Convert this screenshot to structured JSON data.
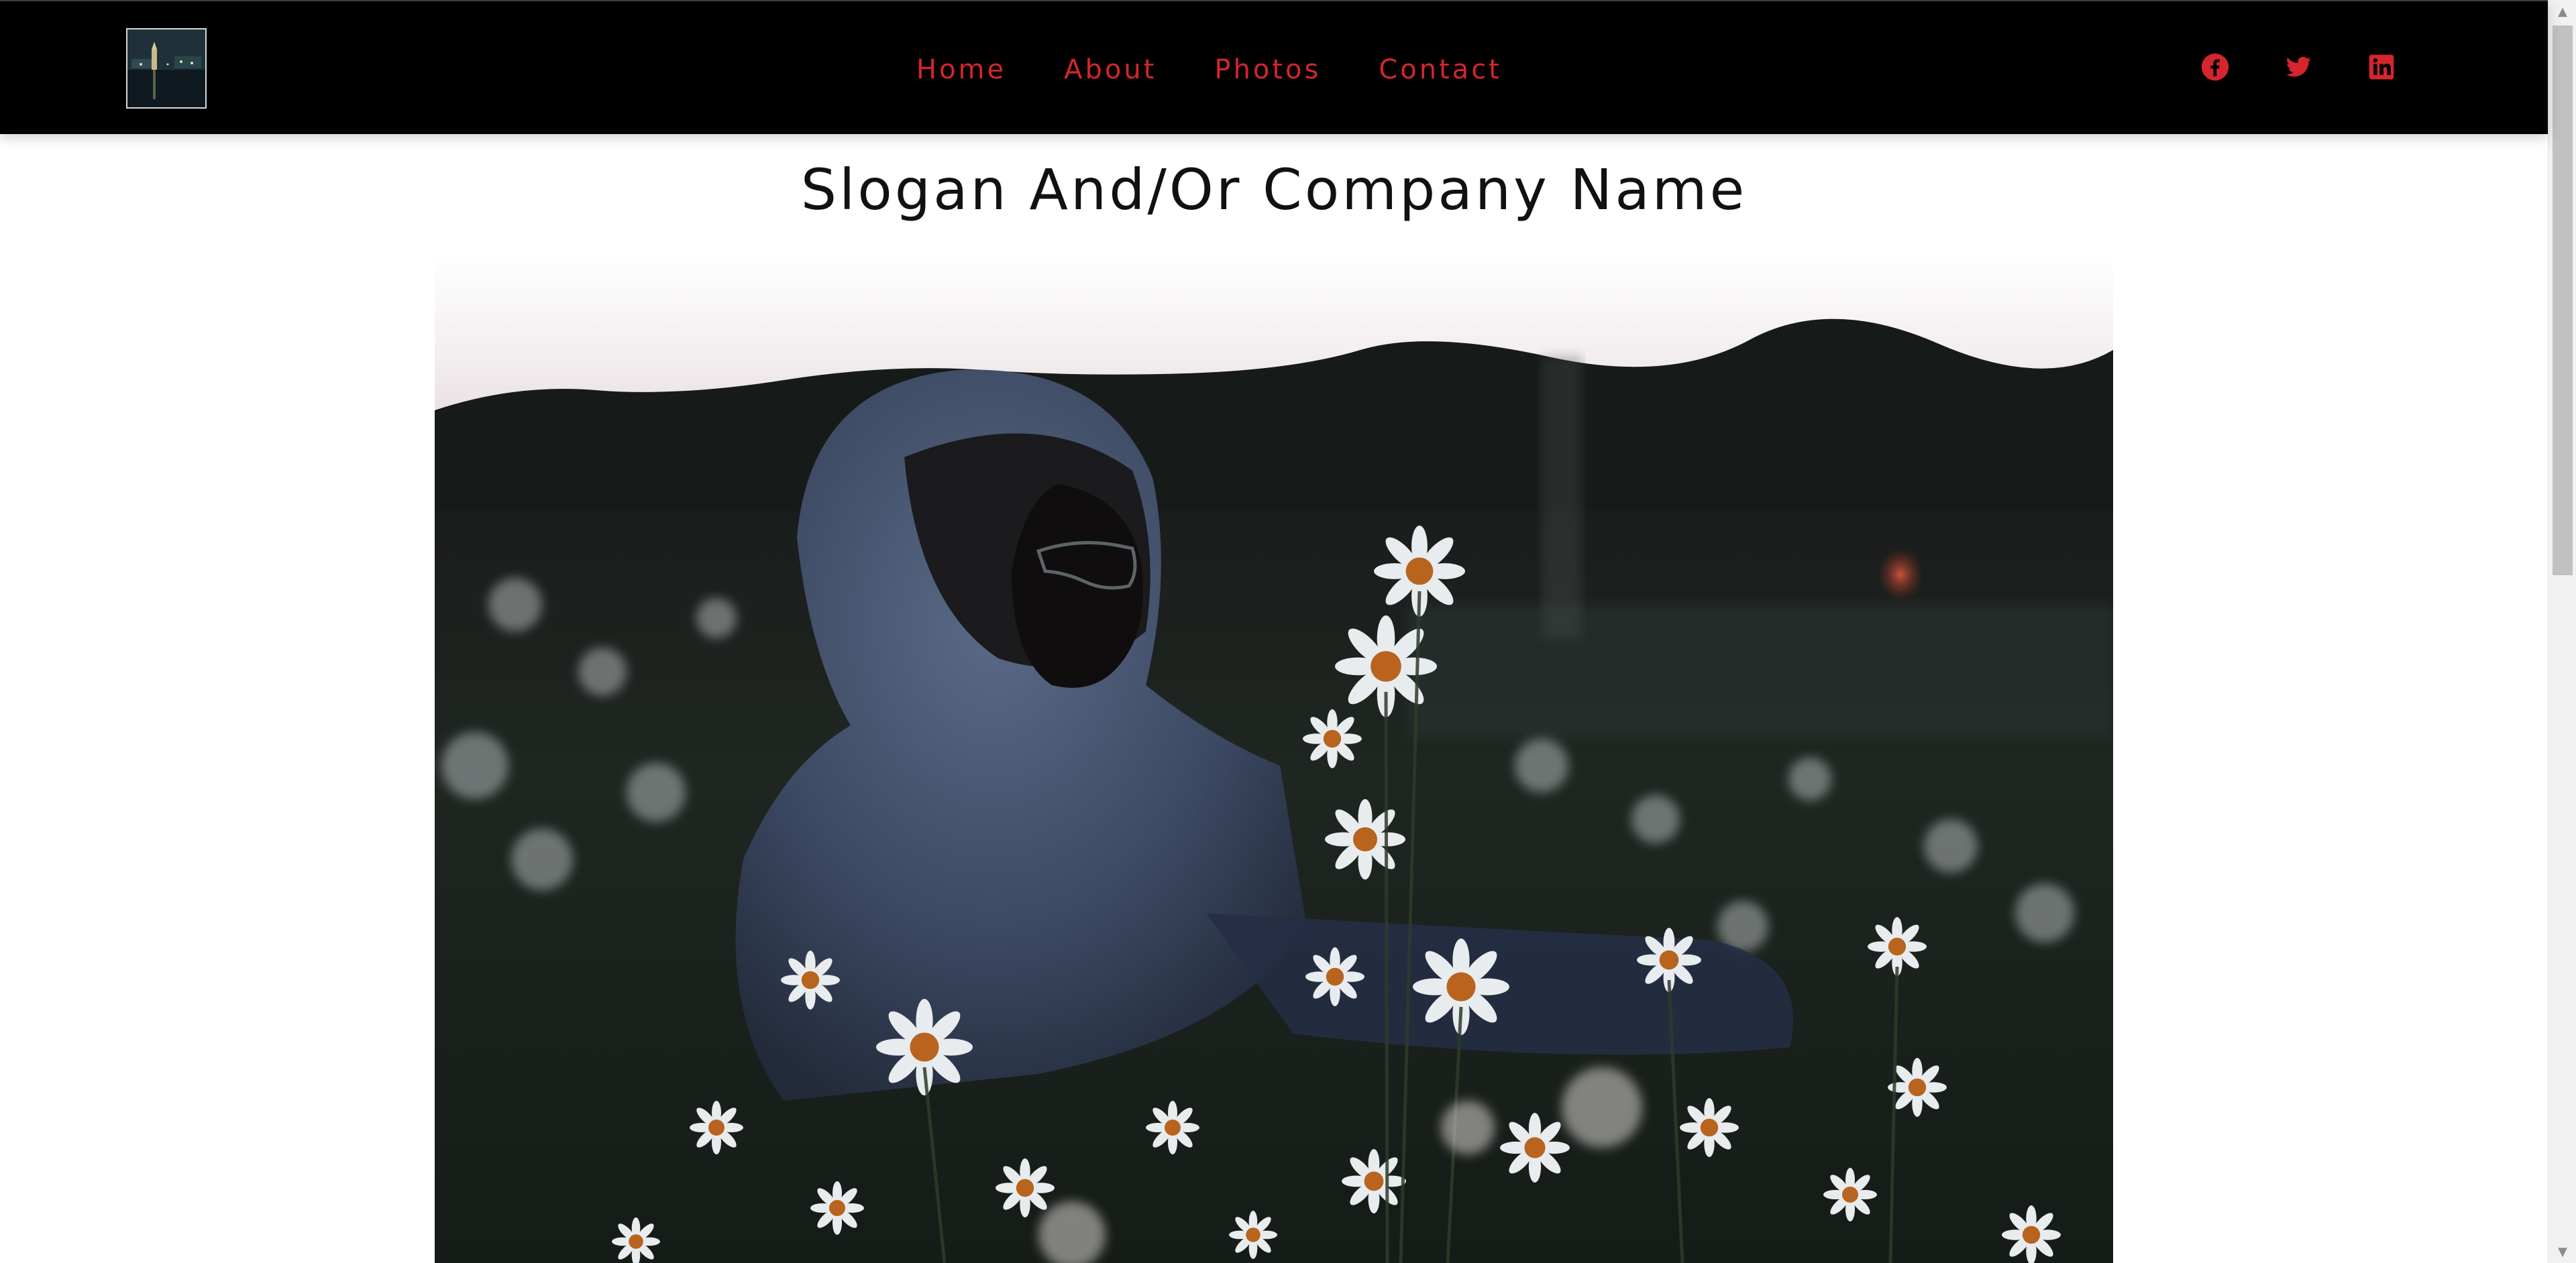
{
  "nav": {
    "logo_alt": "logo",
    "links": [
      "Home",
      "About",
      "Photos",
      "Contact"
    ],
    "link_color": "#d4262c",
    "social": [
      {
        "name": "facebook-icon"
      },
      {
        "name": "twitter-icon"
      },
      {
        "name": "linkedin-icon"
      }
    ]
  },
  "main": {
    "slogan": "Slogan And/Or Company Name",
    "hero_image": "person in hooded sweatshirt among daisies at dusk"
  },
  "colors": {
    "navbar_bg": "#000000",
    "accent": "#d4262c",
    "page_bg": "#ffffff"
  }
}
